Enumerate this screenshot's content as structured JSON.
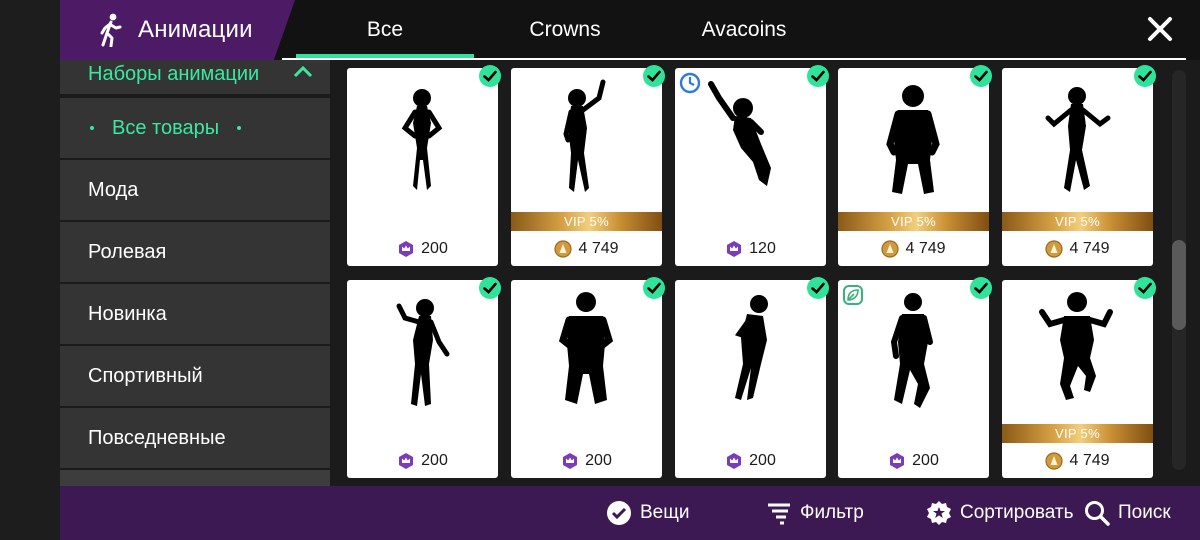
{
  "header": {
    "title": "Анимации",
    "tabs": [
      {
        "label": "Все",
        "active": true
      },
      {
        "label": "Crowns",
        "active": false
      },
      {
        "label": "Avacoins",
        "active": false
      }
    ],
    "close_icon": "close-icon",
    "accent_color": "#2fe39a"
  },
  "sidebar": {
    "items": [
      {
        "label": "Наборы анимации",
        "active": false
      },
      {
        "label": "Все товары",
        "active": true
      },
      {
        "label": "Мода",
        "active": false
      },
      {
        "label": "Ролевая",
        "active": false
      },
      {
        "label": "Новинка",
        "active": false
      },
      {
        "label": "Спортивный",
        "active": false
      },
      {
        "label": "Повседневные",
        "active": false
      }
    ]
  },
  "items": [
    {
      "price": "200",
      "currency": "crowns",
      "vip": "",
      "owned": true,
      "badge": ""
    },
    {
      "price": "4 749",
      "currency": "avacoins",
      "vip": "VIP 5%",
      "owned": true,
      "badge": ""
    },
    {
      "price": "120",
      "currency": "crowns",
      "vip": "",
      "owned": true,
      "badge": "clock-icon"
    },
    {
      "price": "4 749",
      "currency": "avacoins",
      "vip": "VIP 5%",
      "owned": true,
      "badge": ""
    },
    {
      "price": "4 749",
      "currency": "avacoins",
      "vip": "VIP 5%",
      "owned": true,
      "badge": ""
    },
    {
      "price": "200",
      "currency": "crowns",
      "vip": "",
      "owned": true,
      "badge": ""
    },
    {
      "price": "200",
      "currency": "crowns",
      "vip": "",
      "owned": true,
      "badge": ""
    },
    {
      "price": "200",
      "currency": "crowns",
      "vip": "",
      "owned": true,
      "badge": ""
    },
    {
      "price": "200",
      "currency": "crowns",
      "vip": "",
      "owned": true,
      "badge": "leaf-icon"
    },
    {
      "price": "4 749",
      "currency": "avacoins",
      "vip": "VIP 5%",
      "owned": true,
      "badge": ""
    }
  ],
  "bottom_bar": {
    "items_label": "Вещи",
    "filter_label": "Фильтр",
    "sort_label": "Сортировать",
    "search_label": "Поиск"
  },
  "colors": {
    "brand_purple": "#4d1a66",
    "bottom_bar": "#3c1952",
    "check_green": "#2fe39a",
    "crown_purple": "#7a3cb8",
    "avacoin_gold": "#d19a3e"
  }
}
